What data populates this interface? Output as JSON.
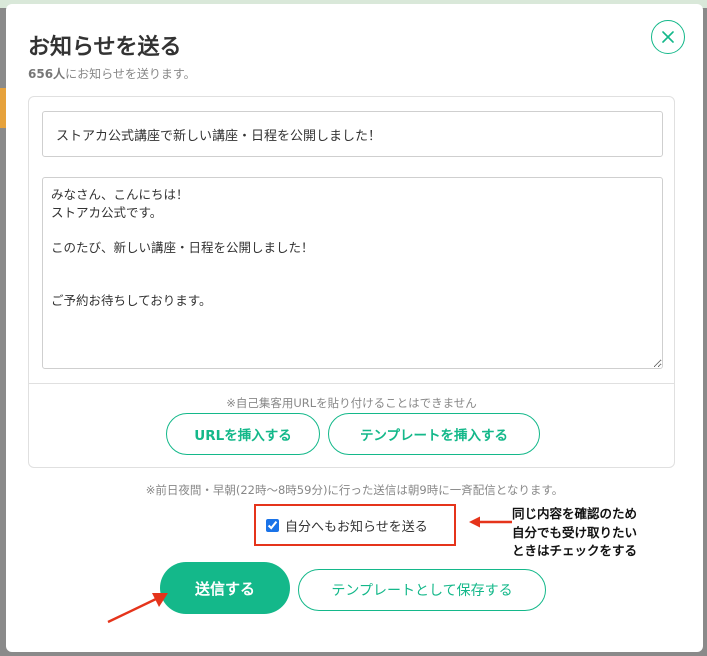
{
  "modal": {
    "title": "お知らせを送る",
    "subtitle_count": "656人",
    "subtitle_text": "にお知らせを送ります。",
    "close_icon": "close-icon"
  },
  "form": {
    "subject_value": "ストアカ公式講座で新しい講座・日程を公開しました！",
    "body_value": "みなさん、こんにちは！\nストアカ公式です。\n\nこのたび、新しい講座・日程を公開しました！\n\n\nご予約お待ちしております。",
    "url_note": "※自己集客用URLを貼り付けることはできません",
    "insert_url_label": "URLを挿入する",
    "insert_template_label": "テンプレートを挿入する"
  },
  "schedule_note": "※前日夜間・早朝(22時〜8時59分)に行った送信は朝9時に一斉配信となります。",
  "self_send": {
    "checked": true,
    "label": "自分へもお知らせを送る"
  },
  "annotation": {
    "text": "同じ内容を確認のため\n自分でも受け取りたい\nときはチェックをする",
    "arrow_color": "#e5341b"
  },
  "actions": {
    "send_label": "送信する",
    "save_template_label": "テンプレートとして保存する"
  },
  "colors": {
    "accent": "#14b88a",
    "annotation_red": "#e5341b"
  }
}
